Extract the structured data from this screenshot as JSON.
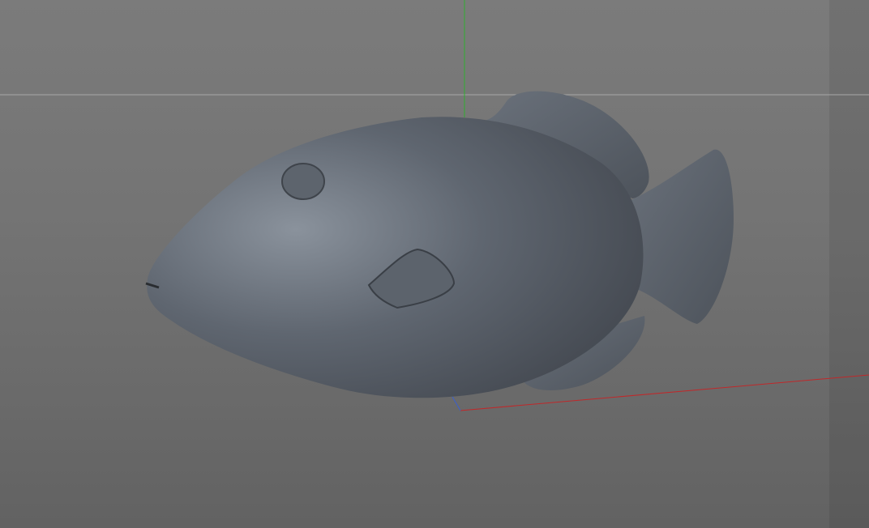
{
  "viewport": {
    "object": "fish-model",
    "colors": {
      "background_top": "#7b7b7b",
      "background_bottom": "#626262",
      "horizon": "#a8a8a8",
      "axis_x": "#c0282a",
      "axis_y": "#2fae2f",
      "axis_z": "#3a5fd0",
      "model_light": "#8a929c",
      "model_dark": "#454a52"
    }
  }
}
